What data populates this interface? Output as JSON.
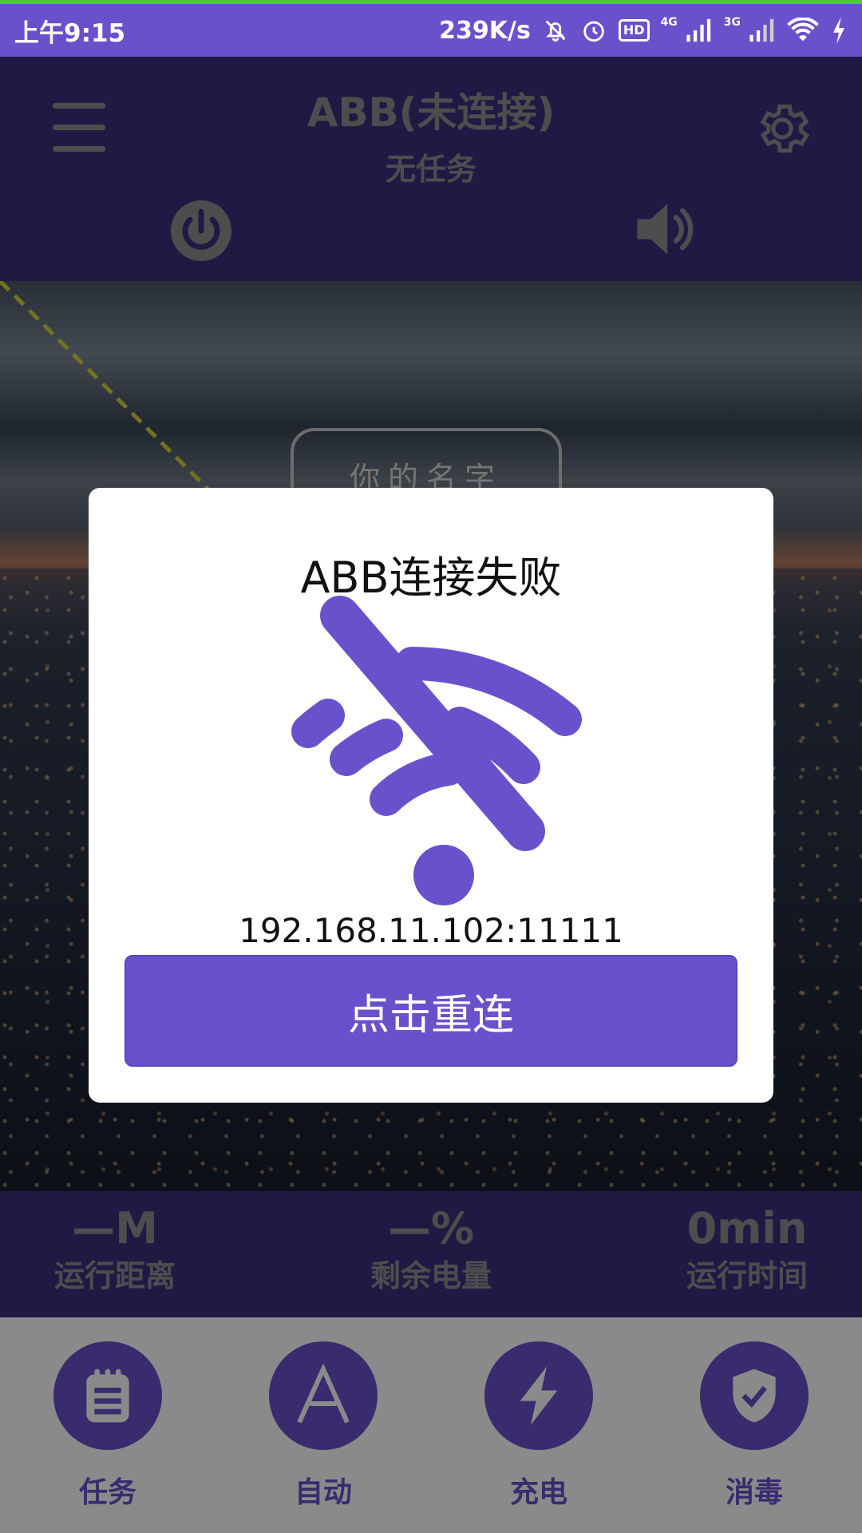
{
  "status_bar": {
    "time": "上午9:15",
    "speed": "239K/s",
    "hd": "HD",
    "net1": "4G",
    "net2": "3G",
    "icons": [
      "mute-bell-icon",
      "alarm-icon",
      "hd-icon",
      "signal-4g-icon",
      "signal-3g-icon",
      "wifi-icon",
      "charging-icon"
    ]
  },
  "header": {
    "title": "ABB(未连接)",
    "subtitle": "无任务",
    "icons": [
      "menu-icon",
      "gear-icon",
      "power-icon",
      "speaker-icon"
    ]
  },
  "map": {
    "name_badge": "你的名字"
  },
  "stats": [
    {
      "value": "—M",
      "label": "运行距离"
    },
    {
      "value": "—%",
      "label": "剩余电量"
    },
    {
      "value": "0min",
      "label": "运行时间"
    }
  ],
  "nav": [
    {
      "label": "任务",
      "icon": "clipboard-icon"
    },
    {
      "label": "自动",
      "icon": "auto-a-icon"
    },
    {
      "label": "充电",
      "icon": "lightning-icon"
    },
    {
      "label": "消毒",
      "icon": "shield-check-icon"
    }
  ],
  "dialog": {
    "title": "ABB连接失败",
    "icon": "wifi-off-icon",
    "address": "192.168.11.102:11111",
    "button": "点击重连"
  },
  "colors": {
    "accent": "#6a51cc",
    "header_bg": "#3e2f7e",
    "status_green": "#4ecb2f"
  }
}
